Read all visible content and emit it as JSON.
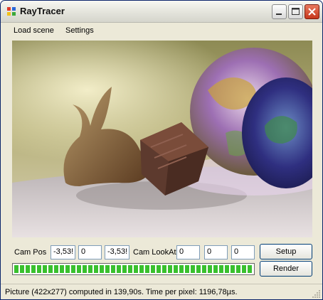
{
  "window": {
    "title": "RayTracer"
  },
  "menu": {
    "load_scene": "Load scene",
    "settings": "Settings"
  },
  "controls": {
    "cam_pos_label": "Cam Pos",
    "cam_pos_x": "-3,53!",
    "cam_pos_y": "0",
    "cam_pos_z": "-3,53!",
    "cam_lookat_label": "Cam LookAt",
    "cam_lookat_x": "0",
    "cam_lookat_y": "0",
    "cam_lookat_z": "0",
    "setup_label": "Setup",
    "render_label": "Render",
    "progress": 1.0
  },
  "status": {
    "text": "Picture (422x277) computed in 139,90s. Time per pixel: 1196,78µs."
  },
  "colors": {
    "accent": "#39c02e",
    "window_bg": "#ece9d8",
    "close_red": "#c6371c"
  }
}
